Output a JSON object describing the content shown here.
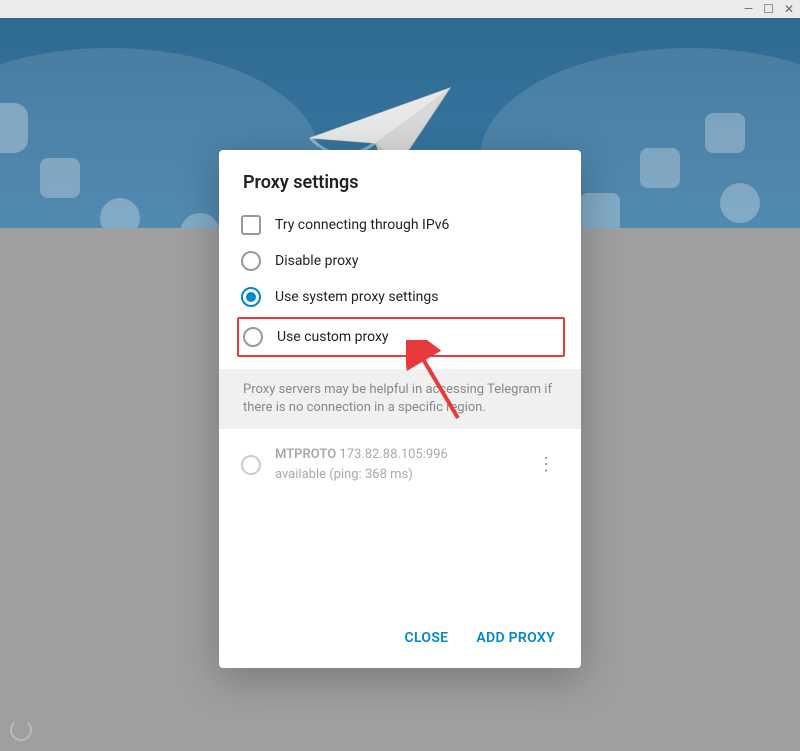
{
  "window_controls": {
    "minimize": "—",
    "maximize": "☐",
    "close": "✕"
  },
  "dialog": {
    "title": "Proxy settings",
    "options": {
      "ipv6": "Try connecting through IPv6",
      "disable": "Disable proxy",
      "system": "Use system proxy settings",
      "custom": "Use custom proxy"
    },
    "selected_option": "system",
    "info_text": "Proxy servers may be helpful in accessing Telegram if there is no connection in a specific region.",
    "proxy": {
      "protocol": "MTPROTO",
      "address": "173.82.88.105:996",
      "status": "available (ping: 368 ms)"
    },
    "actions": {
      "close": "CLOSE",
      "add": "ADD PROXY"
    }
  }
}
